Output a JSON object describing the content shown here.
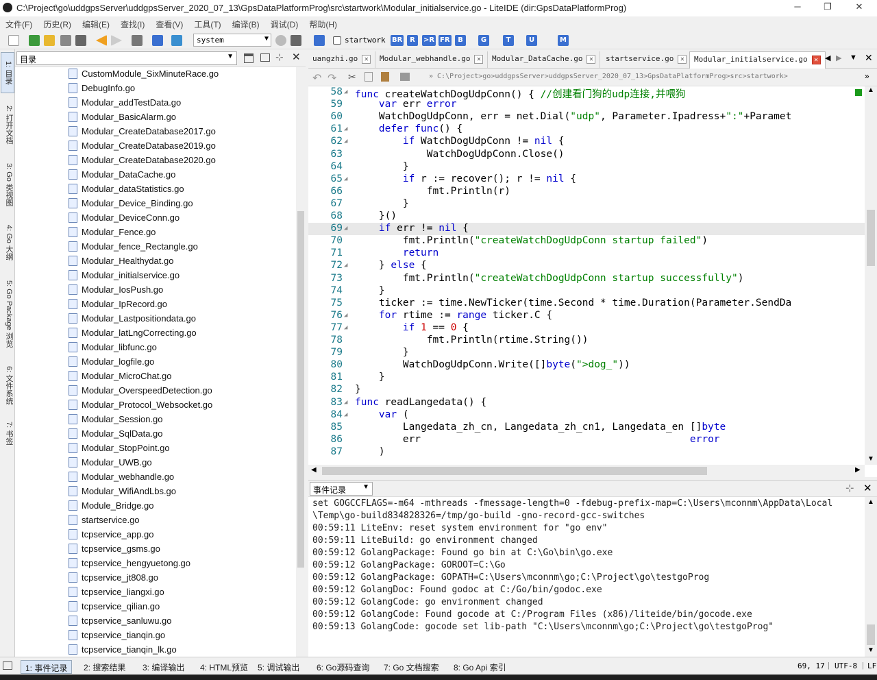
{
  "window": {
    "title": "C:\\Project\\go\\uddgpsServer\\uddgpsServer_2020_07_13\\GpsDataPlatformProg\\src\\startwork\\Modular_initialservice.go - LiteIDE (dir:GpsDataPlatformProg)",
    "min": "─",
    "max": "❐",
    "close": "✕"
  },
  "menu": [
    "文件(F)",
    "历史(R)",
    "编辑(E)",
    "查找(I)",
    "查看(V)",
    "工具(T)",
    "编译(B)",
    "调试(D)",
    "帮助(H)"
  ],
  "toolbar": {
    "env_value": "system",
    "checkbox_label": "startwork",
    "buttons": [
      "BR",
      "R",
      ">R",
      "FR",
      "B",
      "G",
      "T",
      "U",
      "M"
    ]
  },
  "left_tabs": [
    "1: 目录",
    "2: 打开文档",
    "3: Go 类视图",
    "4: Go 大纲",
    "5: Go Package 浏览",
    "6: 文件系统",
    "7: 书签"
  ],
  "sidebar": {
    "combo_value": "目录",
    "files": [
      "CustomModule_SixMinuteRace.go",
      "DebugInfo.go",
      "Modular_addTestData.go",
      "Modular_BasicAlarm.go",
      "Modular_CreateDatabase2017.go",
      "Modular_CreateDatabase2019.go",
      "Modular_CreateDatabase2020.go",
      "Modular_DataCache.go",
      "Modular_dataStatistics.go",
      "Modular_Device_Binding.go",
      "Modular_DeviceConn.go",
      "Modular_Fence.go",
      "Modular_fence_Rectangle.go",
      "Modular_Healthydat.go",
      "Modular_initialservice.go",
      "Modular_IosPush.go",
      "Modular_IpRecord.go",
      "Modular_Lastpositiondata.go",
      "Modular_latLngCorrecting.go",
      "Modular_libfunc.go",
      "Modular_logfile.go",
      "Modular_MicroChat.go",
      "Modular_OverspeedDetection.go",
      "Modular_Protocol_Websocket.go",
      "Modular_Session.go",
      "Modular_SqlData.go",
      "Modular_StopPoint.go",
      "Modular_UWB.go",
      "Modular_webhandle.go",
      "Modular_WifiAndLbs.go",
      "Module_Bridge.go",
      "startservice.go",
      "tcpservice_app.go",
      "tcpservice_gsms.go",
      "tcpservice_hengyuetong.go",
      "tcpservice_jt808.go",
      "tcpservice_liangxi.go",
      "tcpservice_qilian.go",
      "tcpservice_sanluwu.go",
      "tcpservice_tianqin.go",
      "tcpservice_tianqin_lk.go"
    ]
  },
  "editor": {
    "tabs": [
      {
        "label": "uangzhi.go",
        "active": false
      },
      {
        "label": "Modular_webhandle.go",
        "active": false
      },
      {
        "label": "Modular_DataCache.go",
        "active": false
      },
      {
        "label": "startservice.go",
        "active": false
      },
      {
        "label": "Modular_initialservice.go",
        "active": true
      }
    ],
    "breadcrumb": "» C:\\Project>go>uddgpsServer>uddgpsServer_2020_07_13>GpsDataPlatformProg>src>startwork>",
    "lines": [
      {
        "n": "58",
        "fold": true,
        "code": "func createWatchDogUdpConn() { //创建看门狗的udp连接,并喂狗"
      },
      {
        "n": "59",
        "fold": false,
        "code": "    var err error"
      },
      {
        "n": "60",
        "fold": false,
        "code": "    WatchDogUdpConn, err = net.Dial(\"udp\", Parameter.Ipadress+\":\"+Paramet"
      },
      {
        "n": "61",
        "fold": true,
        "code": "    defer func() {"
      },
      {
        "n": "62",
        "fold": true,
        "code": "        if WatchDogUdpConn != nil {"
      },
      {
        "n": "63",
        "fold": false,
        "code": "            WatchDogUdpConn.Close()"
      },
      {
        "n": "64",
        "fold": false,
        "code": "        }"
      },
      {
        "n": "65",
        "fold": true,
        "code": "        if r := recover(); r != nil {"
      },
      {
        "n": "66",
        "fold": false,
        "code": "            fmt.Println(r)"
      },
      {
        "n": "67",
        "fold": false,
        "code": "        }"
      },
      {
        "n": "68",
        "fold": false,
        "code": "    }()"
      },
      {
        "n": "69",
        "fold": true,
        "code": "    if err != nil {"
      },
      {
        "n": "70",
        "fold": false,
        "code": "        fmt.Println(\"createWatchDogUdpConn startup failed\")"
      },
      {
        "n": "71",
        "fold": false,
        "code": "        return"
      },
      {
        "n": "72",
        "fold": true,
        "code": "    } else {"
      },
      {
        "n": "73",
        "fold": false,
        "code": "        fmt.Println(\"createWatchDogUdpConn startup successfully\")"
      },
      {
        "n": "74",
        "fold": false,
        "code": "    }"
      },
      {
        "n": "75",
        "fold": false,
        "code": "    ticker := time.NewTicker(time.Second * time.Duration(Parameter.SendDa"
      },
      {
        "n": "76",
        "fold": true,
        "code": "    for rtime := range ticker.C {"
      },
      {
        "n": "77",
        "fold": true,
        "code": "        if 1 == 0 {"
      },
      {
        "n": "78",
        "fold": false,
        "code": "            fmt.Println(rtime.String())"
      },
      {
        "n": "79",
        "fold": false,
        "code": "        }"
      },
      {
        "n": "80",
        "fold": false,
        "code": "        WatchDogUdpConn.Write([]byte(\">dog_\"))"
      },
      {
        "n": "81",
        "fold": false,
        "code": "    }"
      },
      {
        "n": "82",
        "fold": false,
        "code": "}"
      },
      {
        "n": "83",
        "fold": true,
        "code": "func readLangedata() {"
      },
      {
        "n": "84",
        "fold": true,
        "code": "    var ("
      },
      {
        "n": "85",
        "fold": false,
        "code": "        Langedata_zh_cn, Langedata_zh_cn1, Langedata_en []byte"
      },
      {
        "n": "86",
        "fold": false,
        "code": "        err                                             error"
      },
      {
        "n": "87",
        "fold": false,
        "code": "    )"
      }
    ],
    "current_line": "69"
  },
  "output": {
    "combo_value": "事件记录",
    "lines": [
      "set GOGCCFLAGS=-m64 -mthreads -fmessage-length=0 -fdebug-prefix-map=C:\\Users\\mconnm\\AppData\\Local",
      "\\Temp\\go-build834828326=/tmp/go-build -gno-record-gcc-switches",
      "00:59:11 LiteEnv: reset system environment for \"go env\"",
      "00:59:11 LiteBuild: go environment changed",
      "00:59:12 GolangPackage: Found go bin at C:\\Go\\bin\\go.exe",
      "00:59:12 GolangPackage: GOROOT=C:\\Go",
      "00:59:12 GolangPackage: GOPATH=C:\\Users\\mconnm\\go;C:\\Project\\go\\testgoProg",
      "00:59:12 GolangDoc: Found godoc at C:/Go/bin/godoc.exe",
      "00:59:12 GolangCode: go environment changed",
      "00:59:12 GolangCode: Found gocode at C:/Program Files (x86)/liteide/bin/gocode.exe",
      "00:59:13 GolangCode: gocode set lib-path \"C:\\Users\\mconnm\\go;C:\\Project\\go\\testgoProg\""
    ]
  },
  "status": {
    "tabs": [
      "1: 事件记录",
      "2: 搜索结果",
      "3: 编译输出",
      "4: HTML预览",
      "5: 调试输出",
      "6: Go源码查询",
      "7: Go 文档搜索",
      "8: Go Api 索引"
    ],
    "position": "69, 17",
    "encoding": "UTF-8",
    "eol": "LF"
  }
}
